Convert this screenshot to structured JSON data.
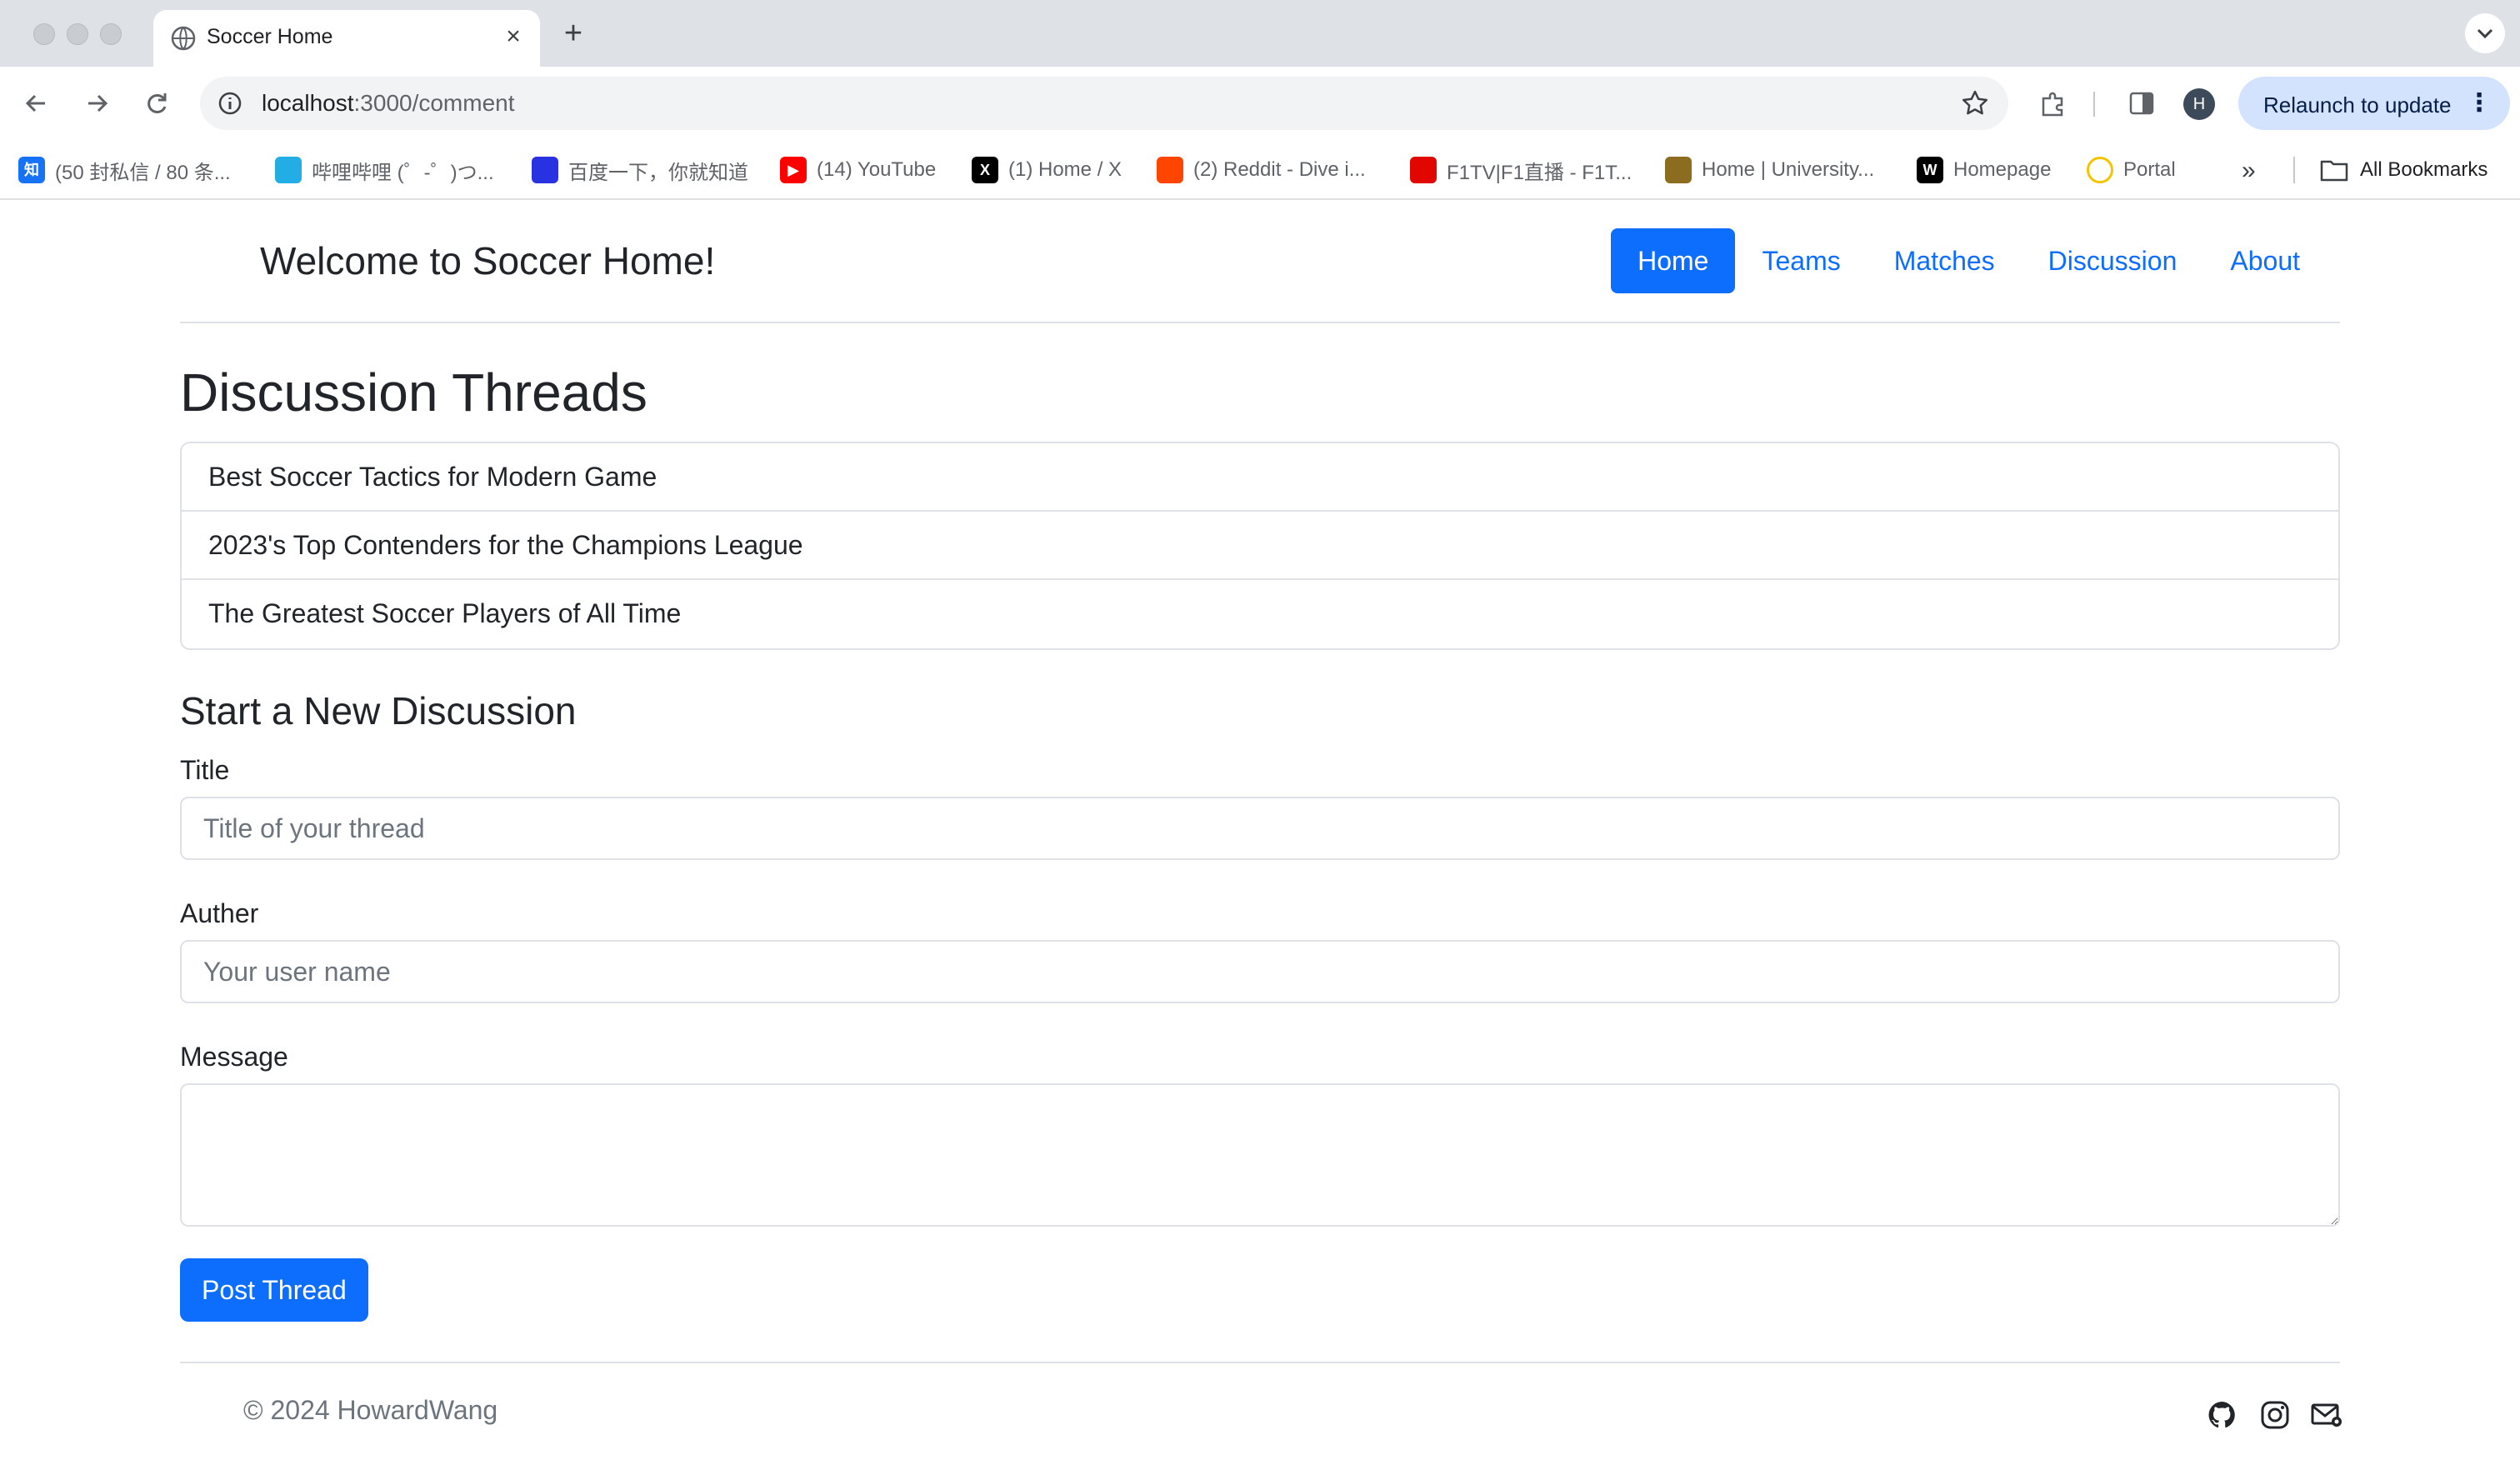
{
  "browser": {
    "tab_title": "Soccer Home",
    "tab_close": "×",
    "new_tab": "+",
    "url_host": "localhost",
    "url_path": ":3000/comment",
    "profile_initial": "H",
    "relaunch_label": "Relaunch to update",
    "bookmarks": [
      {
        "label": "(50 封私信 / 80 条...",
        "icon": "zhihu-icon",
        "icon_text": "知",
        "color": "#1772f6"
      },
      {
        "label": "哔哩哔哩 (゜-゜)つ...",
        "icon": "bilibili-icon",
        "icon_text": "",
        "color": "#23ade5"
      },
      {
        "label": "百度一下，你就知道",
        "icon": "baidu-icon",
        "icon_text": "",
        "color": "#2932e1"
      },
      {
        "label": "(14) YouTube",
        "icon": "youtube-icon",
        "icon_text": "▶",
        "color": "#ff0000"
      },
      {
        "label": "(1) Home / X",
        "icon": "x-icon",
        "icon_text": "X",
        "color": "#000000"
      },
      {
        "label": "(2) Reddit - Dive i...",
        "icon": "reddit-icon",
        "icon_text": "",
        "color": "#ff4500"
      },
      {
        "label": "F1TV|F1直播 - F1T...",
        "icon": "f1-icon",
        "icon_text": "",
        "color": "#e10600"
      },
      {
        "label": "Home | University...",
        "icon": "university-icon",
        "icon_text": "",
        "color": "#8c6d1f"
      },
      {
        "label": "Homepage",
        "icon": "w-icon",
        "icon_text": "W",
        "color": "#000000"
      },
      {
        "label": "Portal",
        "icon": "portal-icon",
        "icon_text": "",
        "color": "#f5c400"
      }
    ],
    "bookmarks_more": "»",
    "all_bookmarks": "All Bookmarks"
  },
  "site": {
    "brand": "Welcome to Soccer Home!",
    "nav": [
      {
        "label": "Home",
        "active": true
      },
      {
        "label": "Teams",
        "active": false
      },
      {
        "label": "Matches",
        "active": false
      },
      {
        "label": "Discussion",
        "active": false
      },
      {
        "label": "About",
        "active": false
      }
    ]
  },
  "threads": {
    "heading": "Discussion Threads",
    "items": [
      "Best Soccer Tactics for Modern Game",
      "2023's Top Contenders for the Champions League",
      "The Greatest Soccer Players of All Time"
    ]
  },
  "form": {
    "heading": "Start a New Discussion",
    "title_label": "Title",
    "title_placeholder": "Title of your thread",
    "author_label": "Auther",
    "author_placeholder": "Your user name",
    "message_label": "Message",
    "message_value": "",
    "submit_label": "Post Thread"
  },
  "footer": {
    "copyright": "© 2024 HowardWang",
    "social": [
      "github-icon",
      "instagram-icon",
      "email-icon"
    ]
  },
  "colors": {
    "primary": "#0d6efd",
    "border": "#dee2e6",
    "muted": "#6c757d"
  }
}
